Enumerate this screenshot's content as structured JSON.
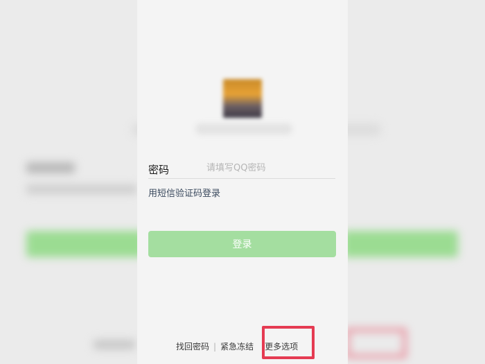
{
  "login": {
    "password_label": "密码",
    "password_placeholder": "请填写QQ密码",
    "sms_login_link": "用短信验证码登录",
    "login_button": "登录"
  },
  "footer": {
    "recover_password": "找回密码",
    "separator": "|",
    "emergency_freeze": "紧急冻结",
    "more_options": "更多选项"
  },
  "colors": {
    "login_button_bg": "#a4dea0",
    "highlight_border": "#e53b52",
    "link_text": "#3b4a5e"
  }
}
